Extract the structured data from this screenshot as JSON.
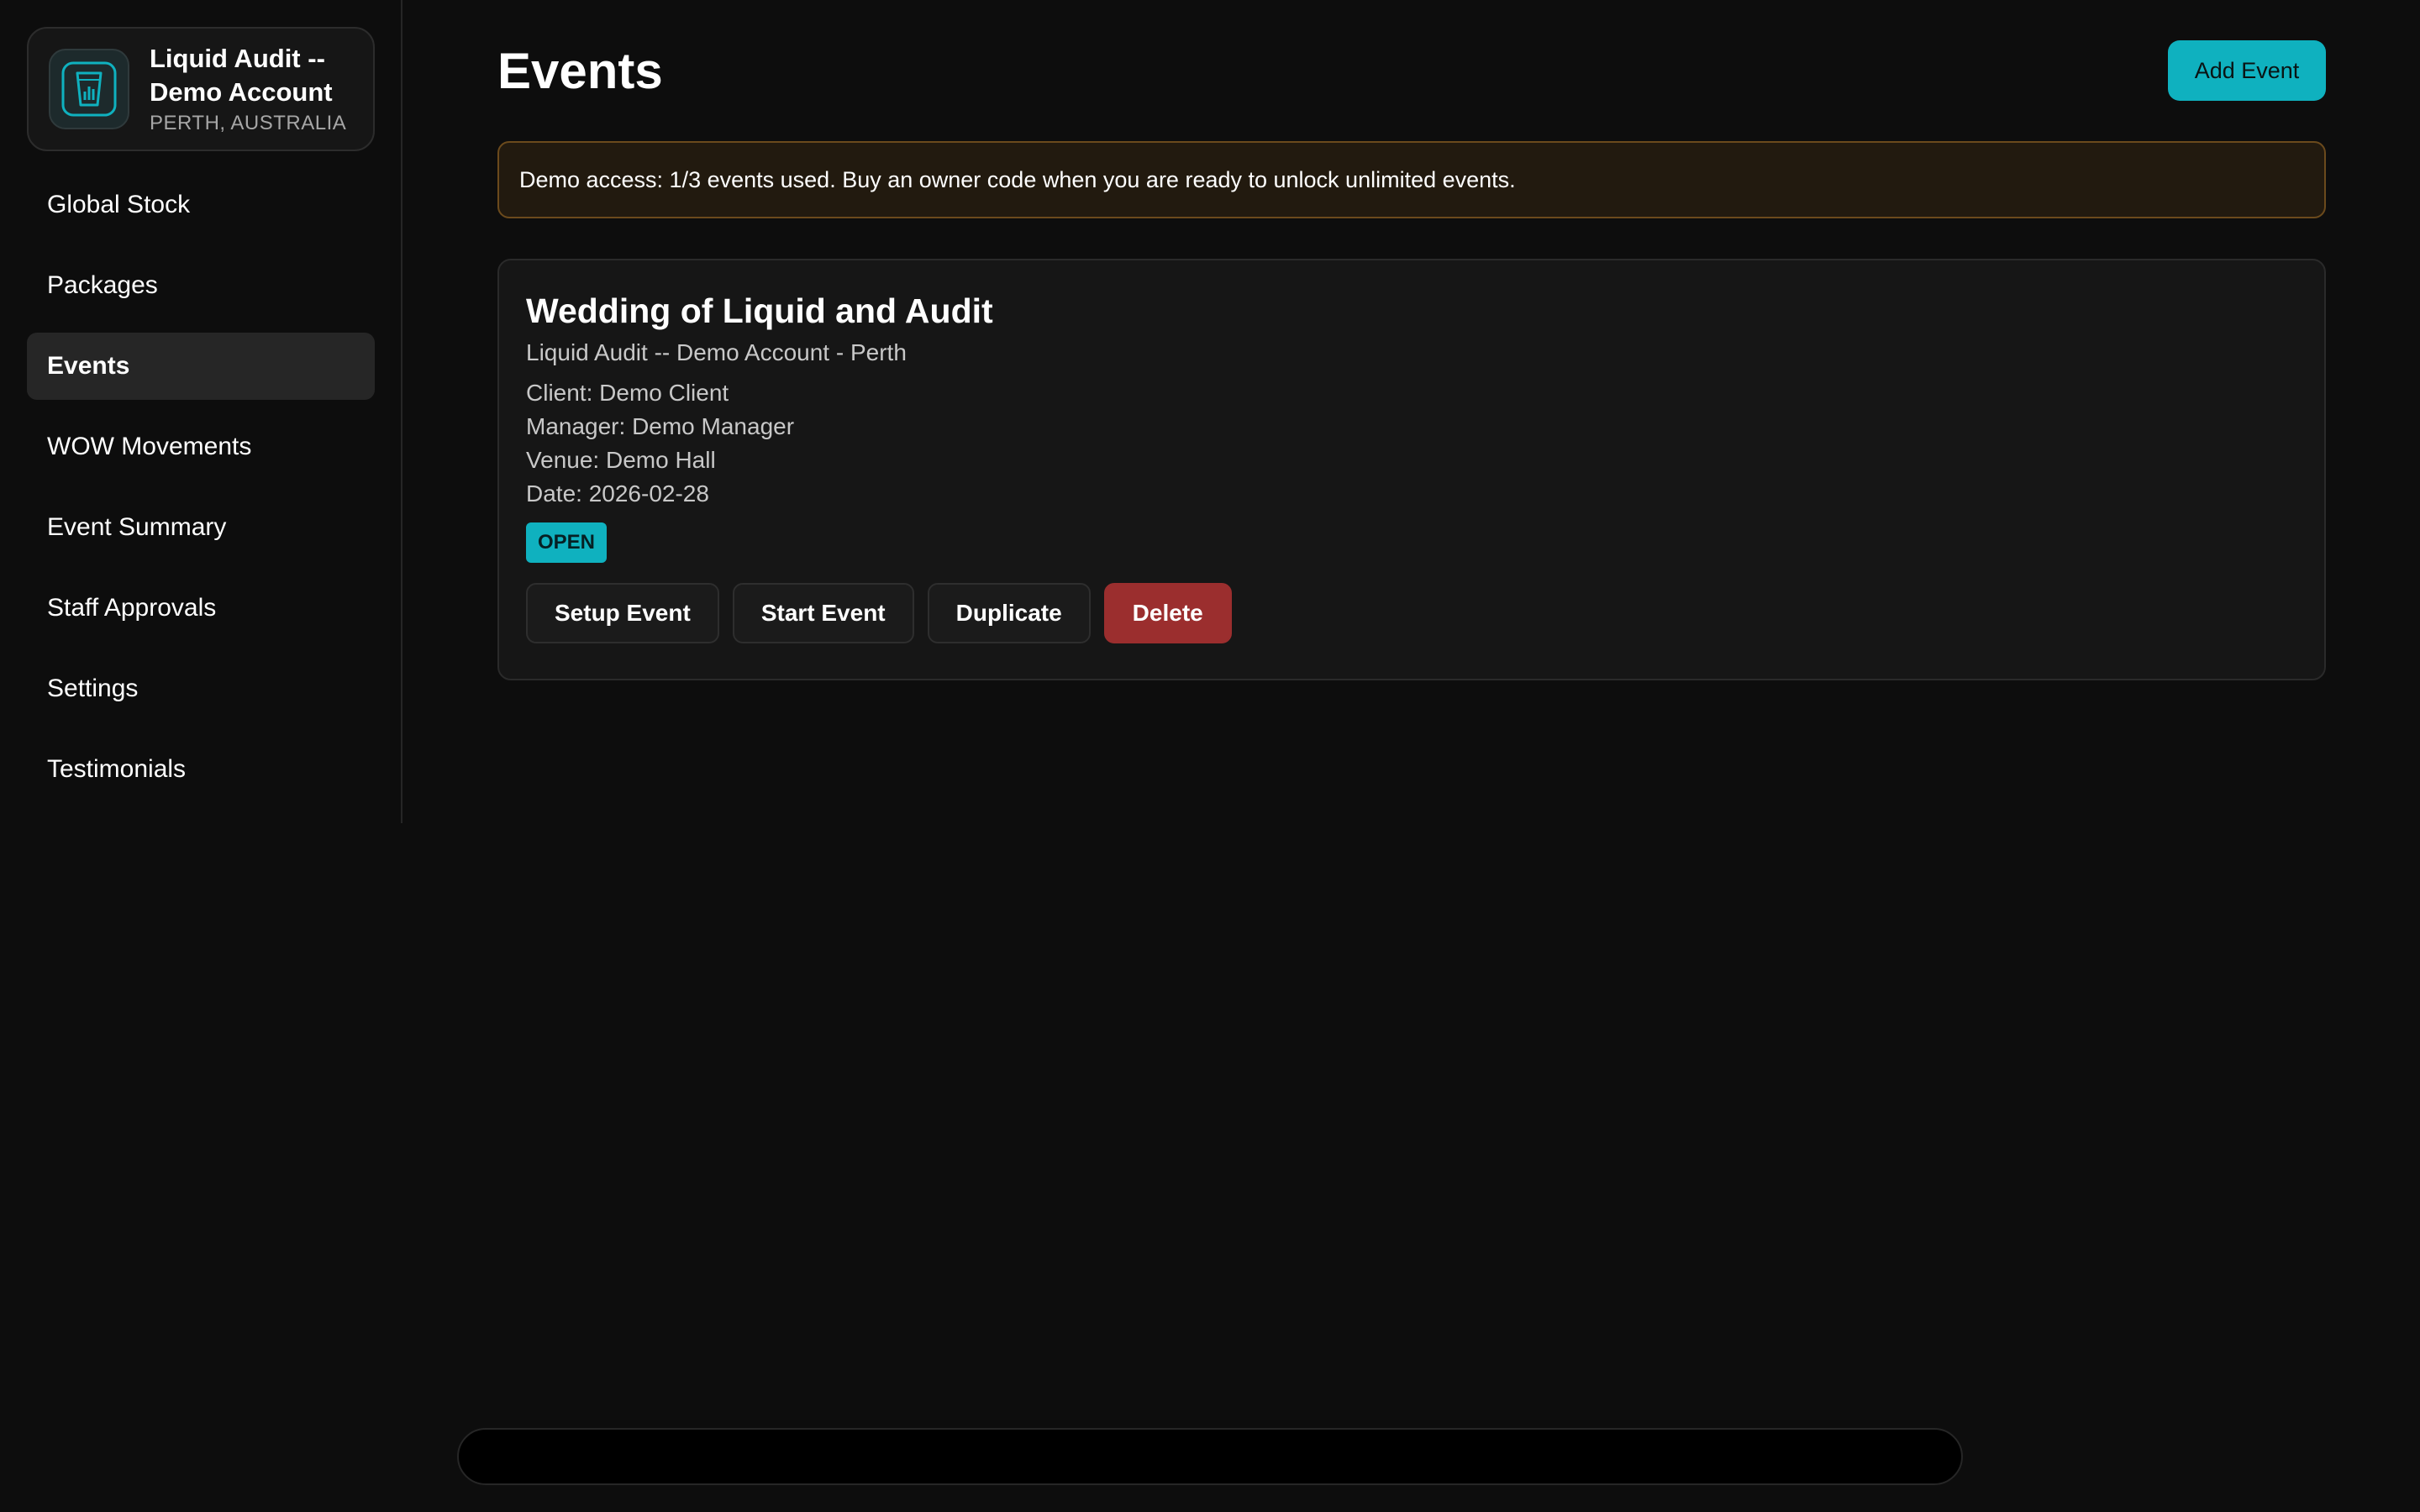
{
  "sidebar": {
    "brand": {
      "name_line1": "Liquid Audit --",
      "name_line2": "Demo Account",
      "location": "PERTH, AUSTRALIA",
      "logo_icon": "glass-chart-icon"
    },
    "items": [
      {
        "label": "Global Stock"
      },
      {
        "label": "Packages"
      },
      {
        "label": "Events",
        "active": true
      },
      {
        "label": "WOW Movements"
      },
      {
        "label": "Event Summary"
      },
      {
        "label": "Staff Approvals"
      },
      {
        "label": "Settings"
      },
      {
        "label": "Testimonials"
      }
    ]
  },
  "header": {
    "title": "Events",
    "add_button": "Add Event"
  },
  "banner": {
    "text": "Demo access: 1/3 events used. Buy an owner code when you are ready to unlock unlimited events."
  },
  "event": {
    "title": "Wedding of Liquid and Audit",
    "subtitle": "Liquid Audit -- Demo Account - Perth",
    "client": "Client: Demo Client",
    "manager": "Manager: Demo Manager",
    "venue": "Venue: Demo Hall",
    "date": "Date: 2026-02-28",
    "status": "OPEN",
    "actions": {
      "setup": "Setup Event",
      "start": "Start Event",
      "duplicate": "Duplicate",
      "delete": "Delete"
    }
  },
  "colors": {
    "accent": "#0fb1bf",
    "danger": "#9b2e2e",
    "background": "#0d0d0d",
    "banner_border": "#6b4a1c"
  }
}
